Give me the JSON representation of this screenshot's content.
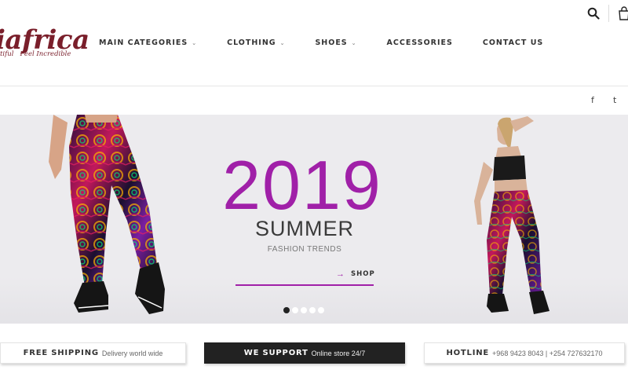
{
  "brand": {
    "logo_text": "iafrica",
    "tagline_left": "tiful",
    "tagline_right": "Feel Incredible"
  },
  "nav": {
    "items": [
      {
        "label": "MAIN CATEGORIES",
        "has_dropdown": true
      },
      {
        "label": "CLOTHING",
        "has_dropdown": true
      },
      {
        "label": "SHOES",
        "has_dropdown": true
      },
      {
        "label": "ACCESSORIES",
        "has_dropdown": false
      },
      {
        "label": "CONTACT US",
        "has_dropdown": false
      }
    ],
    "caret": "⌄"
  },
  "header_icons": {
    "search": "search-icon",
    "cart": "cart-icon"
  },
  "social": {
    "facebook": "f",
    "twitter": "t"
  },
  "hero": {
    "year": "2019",
    "season": "SUMMER",
    "subtitle": "FASHION TRENDS",
    "cta_arrow": "→",
    "cta_label": "SHOP",
    "slides_count": 5,
    "active_slide": 1,
    "background": "#ecebee",
    "accent": "#a020a8"
  },
  "features": [
    {
      "title": "FREE SHIPPING",
      "sub": "Delivery world wide",
      "style": "light"
    },
    {
      "title": "WE SUPPORT",
      "sub": "Online store 24/7",
      "style": "dark"
    },
    {
      "title": "HOTLINE",
      "sub": "+968 9423 8043 | +254 727632170",
      "style": "light"
    }
  ],
  "colors": {
    "brand": "#7a1f2b",
    "accent": "#a020a8",
    "dark": "#222222"
  }
}
